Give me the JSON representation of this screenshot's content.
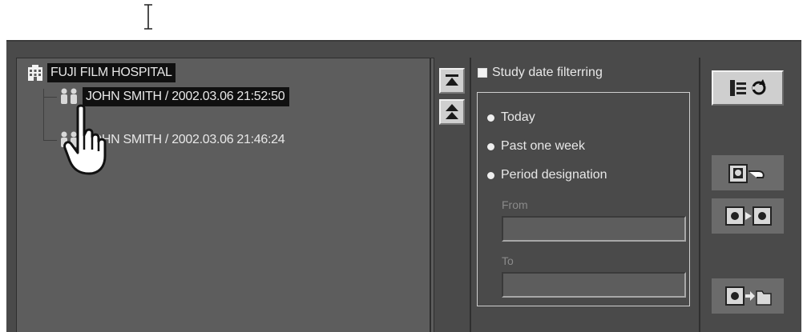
{
  "tree": {
    "root_label": "FUJI FILM HOSPITAL",
    "studies": [
      {
        "label": "JOHN SMITH / 2002.03.06   21:52:50",
        "selected": true
      },
      {
        "label": "JOHN SMITH / 2002.03.06   21:46:24",
        "selected": false
      }
    ]
  },
  "filter": {
    "title": "Study date filterring",
    "options": [
      {
        "label": "Today"
      },
      {
        "label": "Past one week"
      },
      {
        "label": "Period designation"
      }
    ],
    "from_label": "From",
    "from_value": "",
    "to_label": "To",
    "to_value": ""
  },
  "icons": {
    "scroll_top": "scroll-to-top-icon",
    "scroll_up": "scroll-up-icon",
    "refresh": "refresh-tree-icon",
    "send": "send-study-icon",
    "transfer": "study-transfer-icon",
    "export": "export-to-folder-icon"
  },
  "colors": {
    "window_bg": "#4a4a4a",
    "panel_bg": "#5d5d5d",
    "selection_bg": "#101010",
    "text": "#e8e8e8"
  }
}
